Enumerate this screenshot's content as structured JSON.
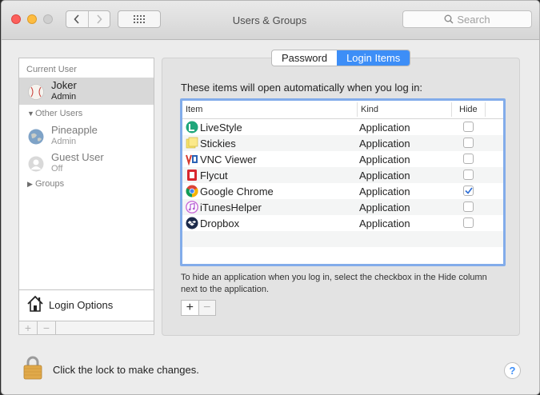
{
  "window": {
    "title": "Users & Groups"
  },
  "search": {
    "placeholder": "Search"
  },
  "sidebar": {
    "current_user_header": "Current User",
    "current_user": {
      "name": "Joker",
      "role": "Admin"
    },
    "other_users_label": "Other Users",
    "other_users": [
      {
        "name": "Pineapple",
        "role": "Admin"
      },
      {
        "name": "Guest User",
        "role": "Off"
      }
    ],
    "groups_label": "Groups",
    "login_options_label": "Login Options",
    "add_symbol": "+",
    "remove_symbol": "−"
  },
  "tabs": [
    {
      "label": "Password",
      "active": false
    },
    {
      "label": "Login Items",
      "active": true
    }
  ],
  "login_items": {
    "intro": "These items will open automatically when you log in:",
    "columns": {
      "item": "Item",
      "kind": "Kind",
      "hide": "Hide"
    },
    "rows": [
      {
        "name": "LiveStyle",
        "kind": "Application",
        "hide": false,
        "icon": "livestyle-icon"
      },
      {
        "name": "Stickies",
        "kind": "Application",
        "hide": false,
        "icon": "stickies-icon"
      },
      {
        "name": "VNC Viewer",
        "kind": "Application",
        "hide": false,
        "icon": "vnc-viewer-icon"
      },
      {
        "name": "Flycut",
        "kind": "Application",
        "hide": false,
        "icon": "flycut-icon"
      },
      {
        "name": "Google Chrome",
        "kind": "Application",
        "hide": true,
        "icon": "chrome-icon"
      },
      {
        "name": "iTunesHelper",
        "kind": "Application",
        "hide": false,
        "icon": "itunes-icon"
      },
      {
        "name": "Dropbox",
        "kind": "Application",
        "hide": false,
        "icon": "dropbox-icon"
      }
    ],
    "note": "To hide an application when you log in, select the checkbox in the Hide column next to the application.",
    "add_symbol": "+",
    "remove_symbol": "−"
  },
  "footer": {
    "lock_text": "Click the lock to make changes.",
    "help_symbol": "?"
  },
  "colors": {
    "accent": "#3d8ef7",
    "selection": "#d8d8d8",
    "table_focus": "#82acea"
  }
}
